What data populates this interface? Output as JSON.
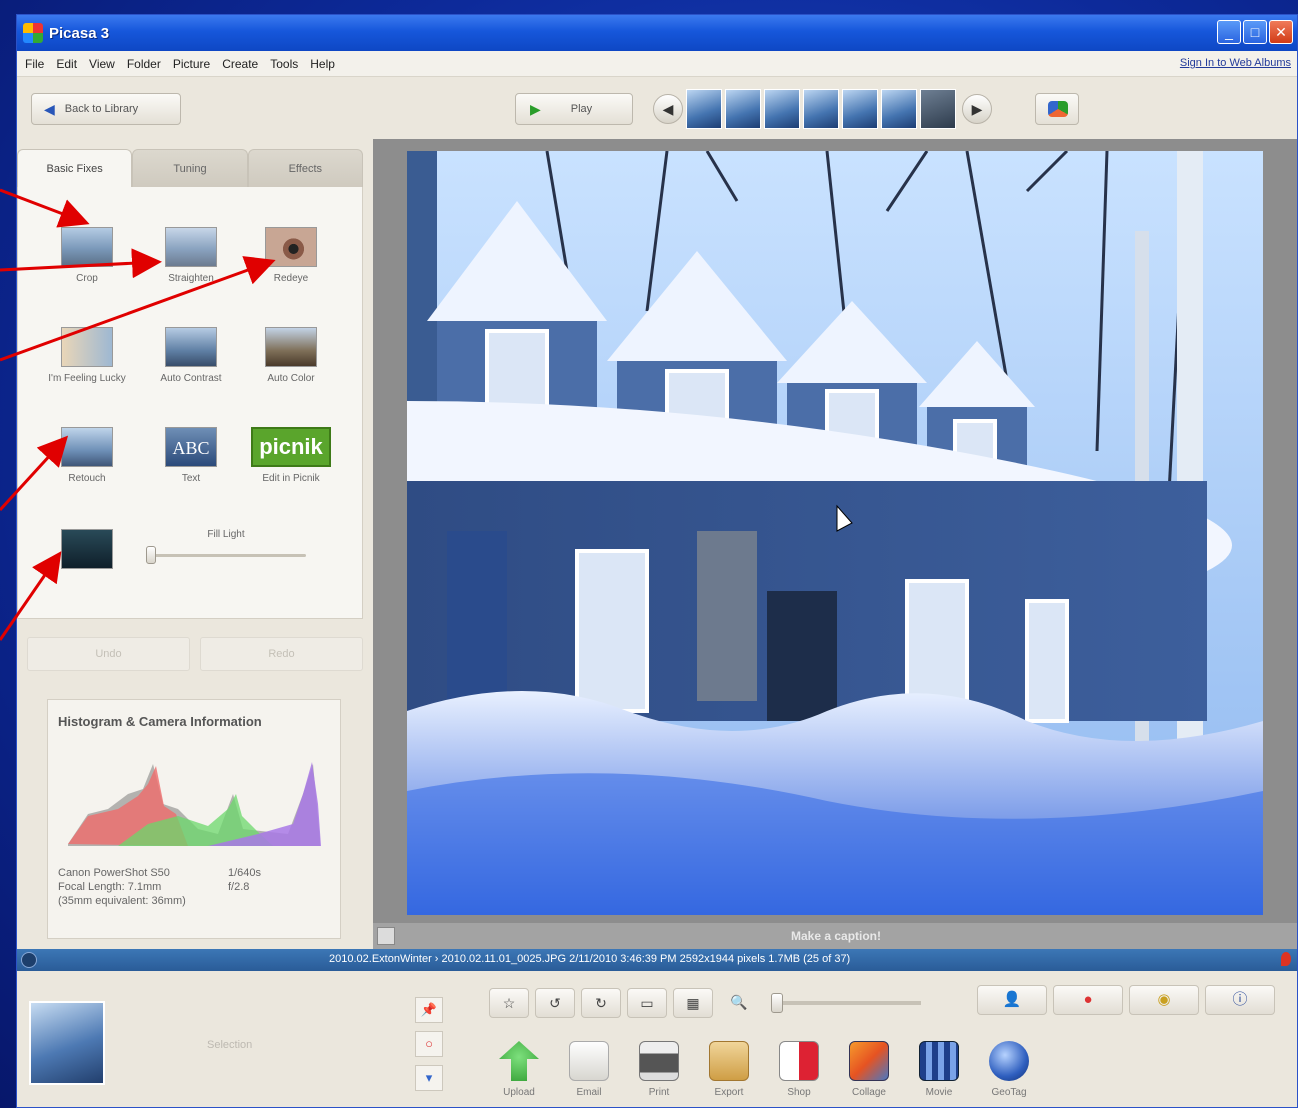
{
  "window": {
    "title": "Picasa 3"
  },
  "menu": {
    "items": [
      "File",
      "Edit",
      "View",
      "Folder",
      "Picture",
      "Create",
      "Tools",
      "Help"
    ],
    "signin": "Sign In to Web Albums"
  },
  "toolbar": {
    "back_label": "Back to Library",
    "play_label": "Play"
  },
  "tabs": [
    "Basic Fixes",
    "Tuning",
    "Effects"
  ],
  "fixes": {
    "crop": "Crop",
    "straighten": "Straighten",
    "redeye": "Redeye",
    "lucky": "I'm Feeling Lucky",
    "auto_contrast": "Auto Contrast",
    "auto_color": "Auto Color",
    "retouch": "Retouch",
    "text": "Text",
    "text_icon": "ABC",
    "picnik": "Edit in Picnik",
    "picnik_icon": "picnik",
    "fill_light": "Fill Light",
    "fill_light_value": 0
  },
  "undo": {
    "undo_label": "Undo",
    "redo_label": "Redo"
  },
  "histogram": {
    "title": "Histogram & Camera Information",
    "camera": "Canon PowerShot S50",
    "focal_length": "Focal Length: 7.1mm",
    "equivalent": "(35mm equivalent: 36mm)",
    "shutter": "1/640s",
    "aperture": "f/2.8"
  },
  "caption": {
    "placeholder": "Make a caption!"
  },
  "status": {
    "text": "2010.02.ExtonWinter › 2010.02.11.01_0025.JPG    2/11/2010 3:46:39 PM    2592x1944 pixels    1.7MB    (25 of 37)"
  },
  "tray": {
    "selection_label": "Selection",
    "actions": [
      "Upload",
      "Email",
      "Print",
      "Export",
      "Shop",
      "Collage",
      "Movie",
      "GeoTag"
    ]
  },
  "colors": {
    "accent": "#1657db",
    "status_bar": "#2a5c98",
    "picnik_green": "#5aa52c"
  }
}
